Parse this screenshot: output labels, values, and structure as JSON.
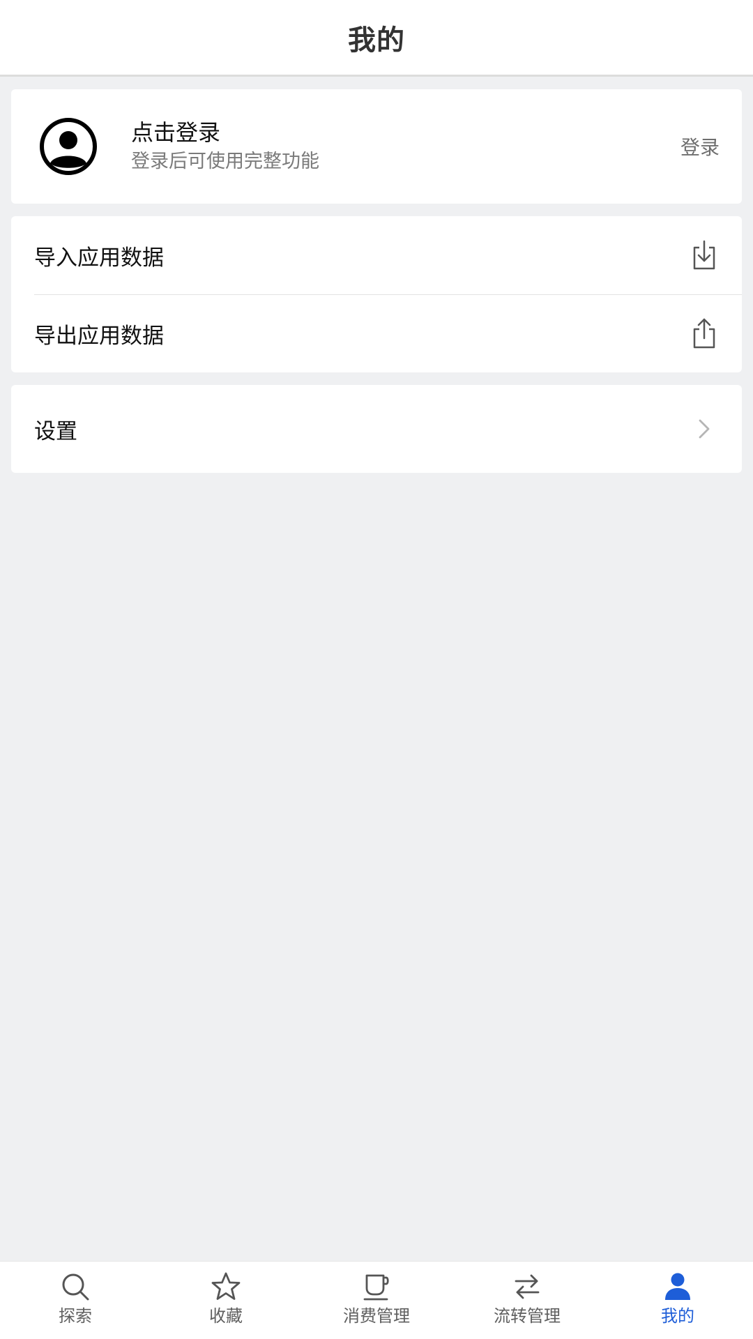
{
  "header": {
    "title": "我的"
  },
  "login_card": {
    "title": "点击登录",
    "subtitle": "登录后可使用完整功能",
    "action": "登录"
  },
  "data_section": {
    "items": [
      {
        "label": "导入应用数据",
        "icon": "import-icon"
      },
      {
        "label": "导出应用数据",
        "icon": "export-icon"
      }
    ]
  },
  "settings_section": {
    "items": [
      {
        "label": "设置",
        "icon": "chevron-right-icon"
      }
    ]
  },
  "bottom_nav": {
    "items": [
      {
        "label": "探索",
        "icon": "search-icon",
        "active": false
      },
      {
        "label": "收藏",
        "icon": "star-icon",
        "active": false
      },
      {
        "label": "消费管理",
        "icon": "cup-icon",
        "active": false
      },
      {
        "label": "流转管理",
        "icon": "transfer-icon",
        "active": false
      },
      {
        "label": "我的",
        "icon": "user-icon",
        "active": true
      }
    ]
  },
  "colors": {
    "accent": "#1e5ed8",
    "background": "#eff0f2",
    "card": "#ffffff",
    "icon_gray": "#555555"
  }
}
